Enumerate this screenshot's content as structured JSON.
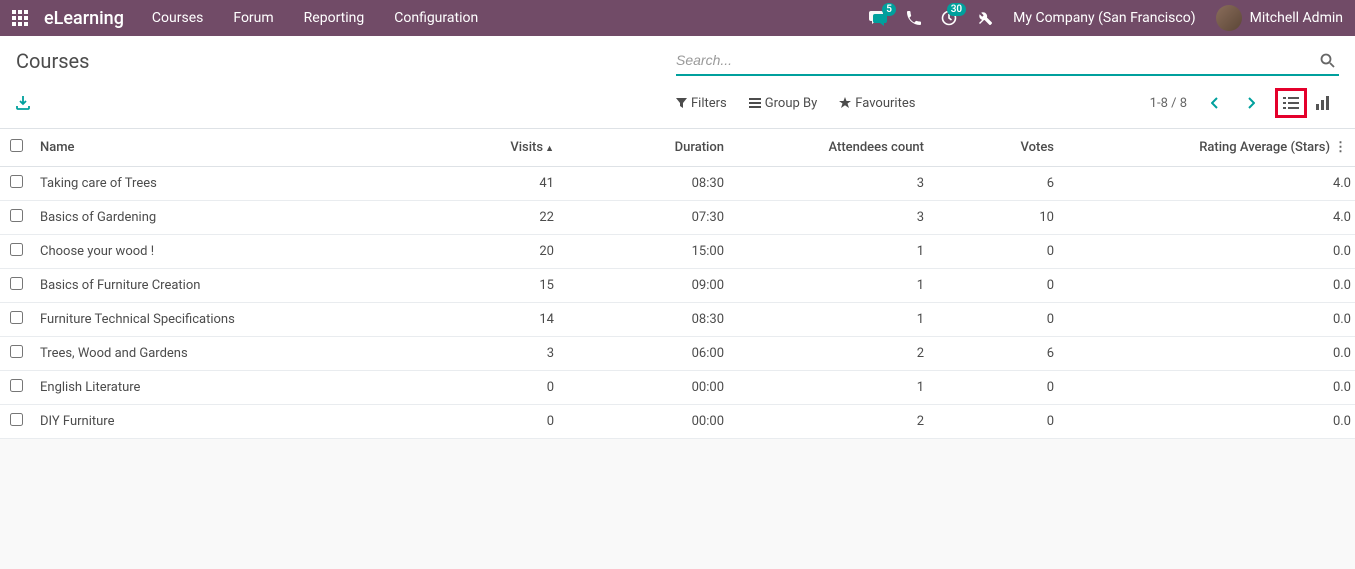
{
  "navbar": {
    "brand": "eLearning",
    "menu": [
      "Courses",
      "Forum",
      "Reporting",
      "Configuration"
    ],
    "messaging_badge": "5",
    "activity_badge": "30",
    "company": "My Company (San Francisco)",
    "user": "Mitchell Admin"
  },
  "page": {
    "title": "Courses",
    "search_placeholder": "Search...",
    "filters_label": "Filters",
    "groupby_label": "Group By",
    "favourites_label": "Favourites",
    "pager": "1-8 / 8"
  },
  "table": {
    "columns": {
      "name": "Name",
      "visits": "Visits",
      "duration": "Duration",
      "attendees": "Attendees count",
      "votes": "Votes",
      "rating": "Rating Average (Stars)"
    },
    "rows": [
      {
        "name": "Taking care of Trees",
        "visits": "41",
        "duration": "08:30",
        "attendees": "3",
        "votes": "6",
        "rating": "4.0"
      },
      {
        "name": "Basics of Gardening",
        "visits": "22",
        "duration": "07:30",
        "attendees": "3",
        "votes": "10",
        "rating": "4.0"
      },
      {
        "name": "Choose your wood !",
        "visits": "20",
        "duration": "15:00",
        "attendees": "1",
        "votes": "0",
        "rating": "0.0"
      },
      {
        "name": "Basics of Furniture Creation",
        "visits": "15",
        "duration": "09:00",
        "attendees": "1",
        "votes": "0",
        "rating": "0.0"
      },
      {
        "name": "Furniture Technical Specifications",
        "visits": "14",
        "duration": "08:30",
        "attendees": "1",
        "votes": "0",
        "rating": "0.0"
      },
      {
        "name": "Trees, Wood and Gardens",
        "visits": "3",
        "duration": "06:00",
        "attendees": "2",
        "votes": "6",
        "rating": "0.0"
      },
      {
        "name": "English Literature",
        "visits": "0",
        "duration": "00:00",
        "attendees": "1",
        "votes": "0",
        "rating": "0.0"
      },
      {
        "name": "DIY Furniture",
        "visits": "0",
        "duration": "00:00",
        "attendees": "2",
        "votes": "0",
        "rating": "0.0"
      }
    ]
  }
}
